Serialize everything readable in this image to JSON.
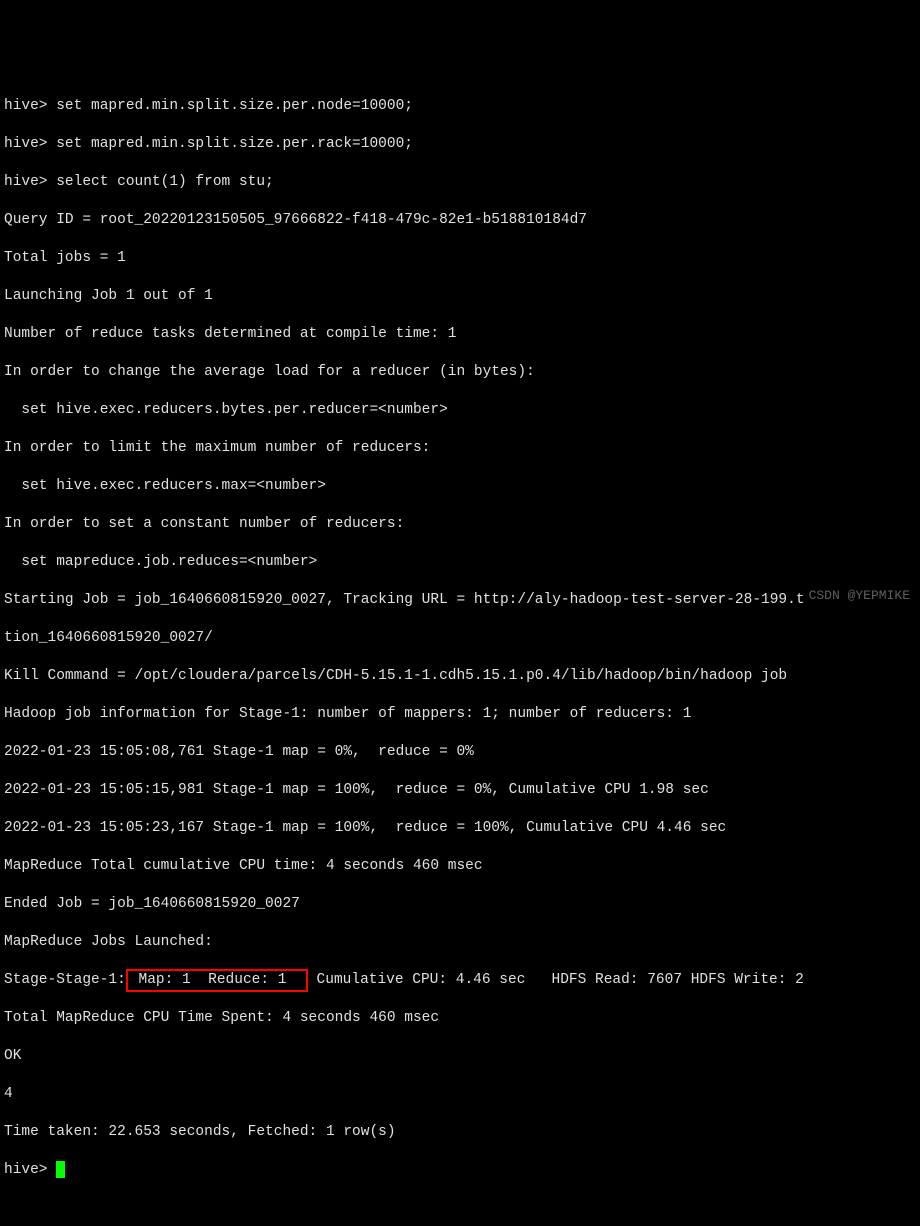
{
  "lines": {
    "l0": "hive> set mapred.min.split.size.per.node=10000;",
    "l1": "hive> set mapred.min.split.size.per.rack=10000;",
    "l2": "hive> select count(1) from stu;",
    "l3": "Query ID = root_20220123150505_97666822-f418-479c-82e1-b518810184d7",
    "l4": "Total jobs = 1",
    "l5": "Launching Job 1 out of 1",
    "l6": "Number of reduce tasks determined at compile time: 1",
    "l7": "In order to change the average load for a reducer (in bytes):",
    "l8": "  set hive.exec.reducers.bytes.per.reducer=<number>",
    "l9": "In order to limit the maximum number of reducers:",
    "l10": "  set hive.exec.reducers.max=<number>",
    "l11": "In order to set a constant number of reducers:",
    "l12": "  set mapreduce.job.reduces=<number>",
    "l13": "Starting Job = job_1640660815920_0027, Tracking URL = http://aly-hadoop-test-server-28-199.t",
    "l14": "tion_1640660815920_0027/",
    "l15": "Kill Command = /opt/cloudera/parcels/CDH-5.15.1-1.cdh5.15.1.p0.4/lib/hadoop/bin/hadoop job",
    "l16": "Hadoop job information for Stage-1: number of mappers: 1; number of reducers: 1",
    "l17": "2022-01-23 15:05:08,761 Stage-1 map = 0%,  reduce = 0%",
    "l18": "2022-01-23 15:05:15,981 Stage-1 map = 100%,  reduce = 0%, Cumulative CPU 1.98 sec",
    "l19": "2022-01-23 15:05:23,167 Stage-1 map = 100%,  reduce = 100%, Cumulative CPU 4.46 sec",
    "l20": "MapReduce Total cumulative CPU time: 4 seconds 460 msec",
    "l21": "Ended Job = job_1640660815920_0027",
    "l22": "MapReduce Jobs Launched:",
    "l23_pre": "Stage-Stage-1:",
    "l23_box": " Map: 1  Reduce: 1  ",
    "l23_post": " Cumulative CPU: 4.46 sec   HDFS Read: 7607 HDFS Write: 2",
    "l24": "Total MapReduce CPU Time Spent: 4 seconds 460 msec",
    "l25": "OK",
    "l26": "4",
    "l27": "Time taken: 22.653 seconds, Fetched: 1 row(s)",
    "l28": "hive> "
  },
  "watermark": "CSDN @YEPMIKE"
}
